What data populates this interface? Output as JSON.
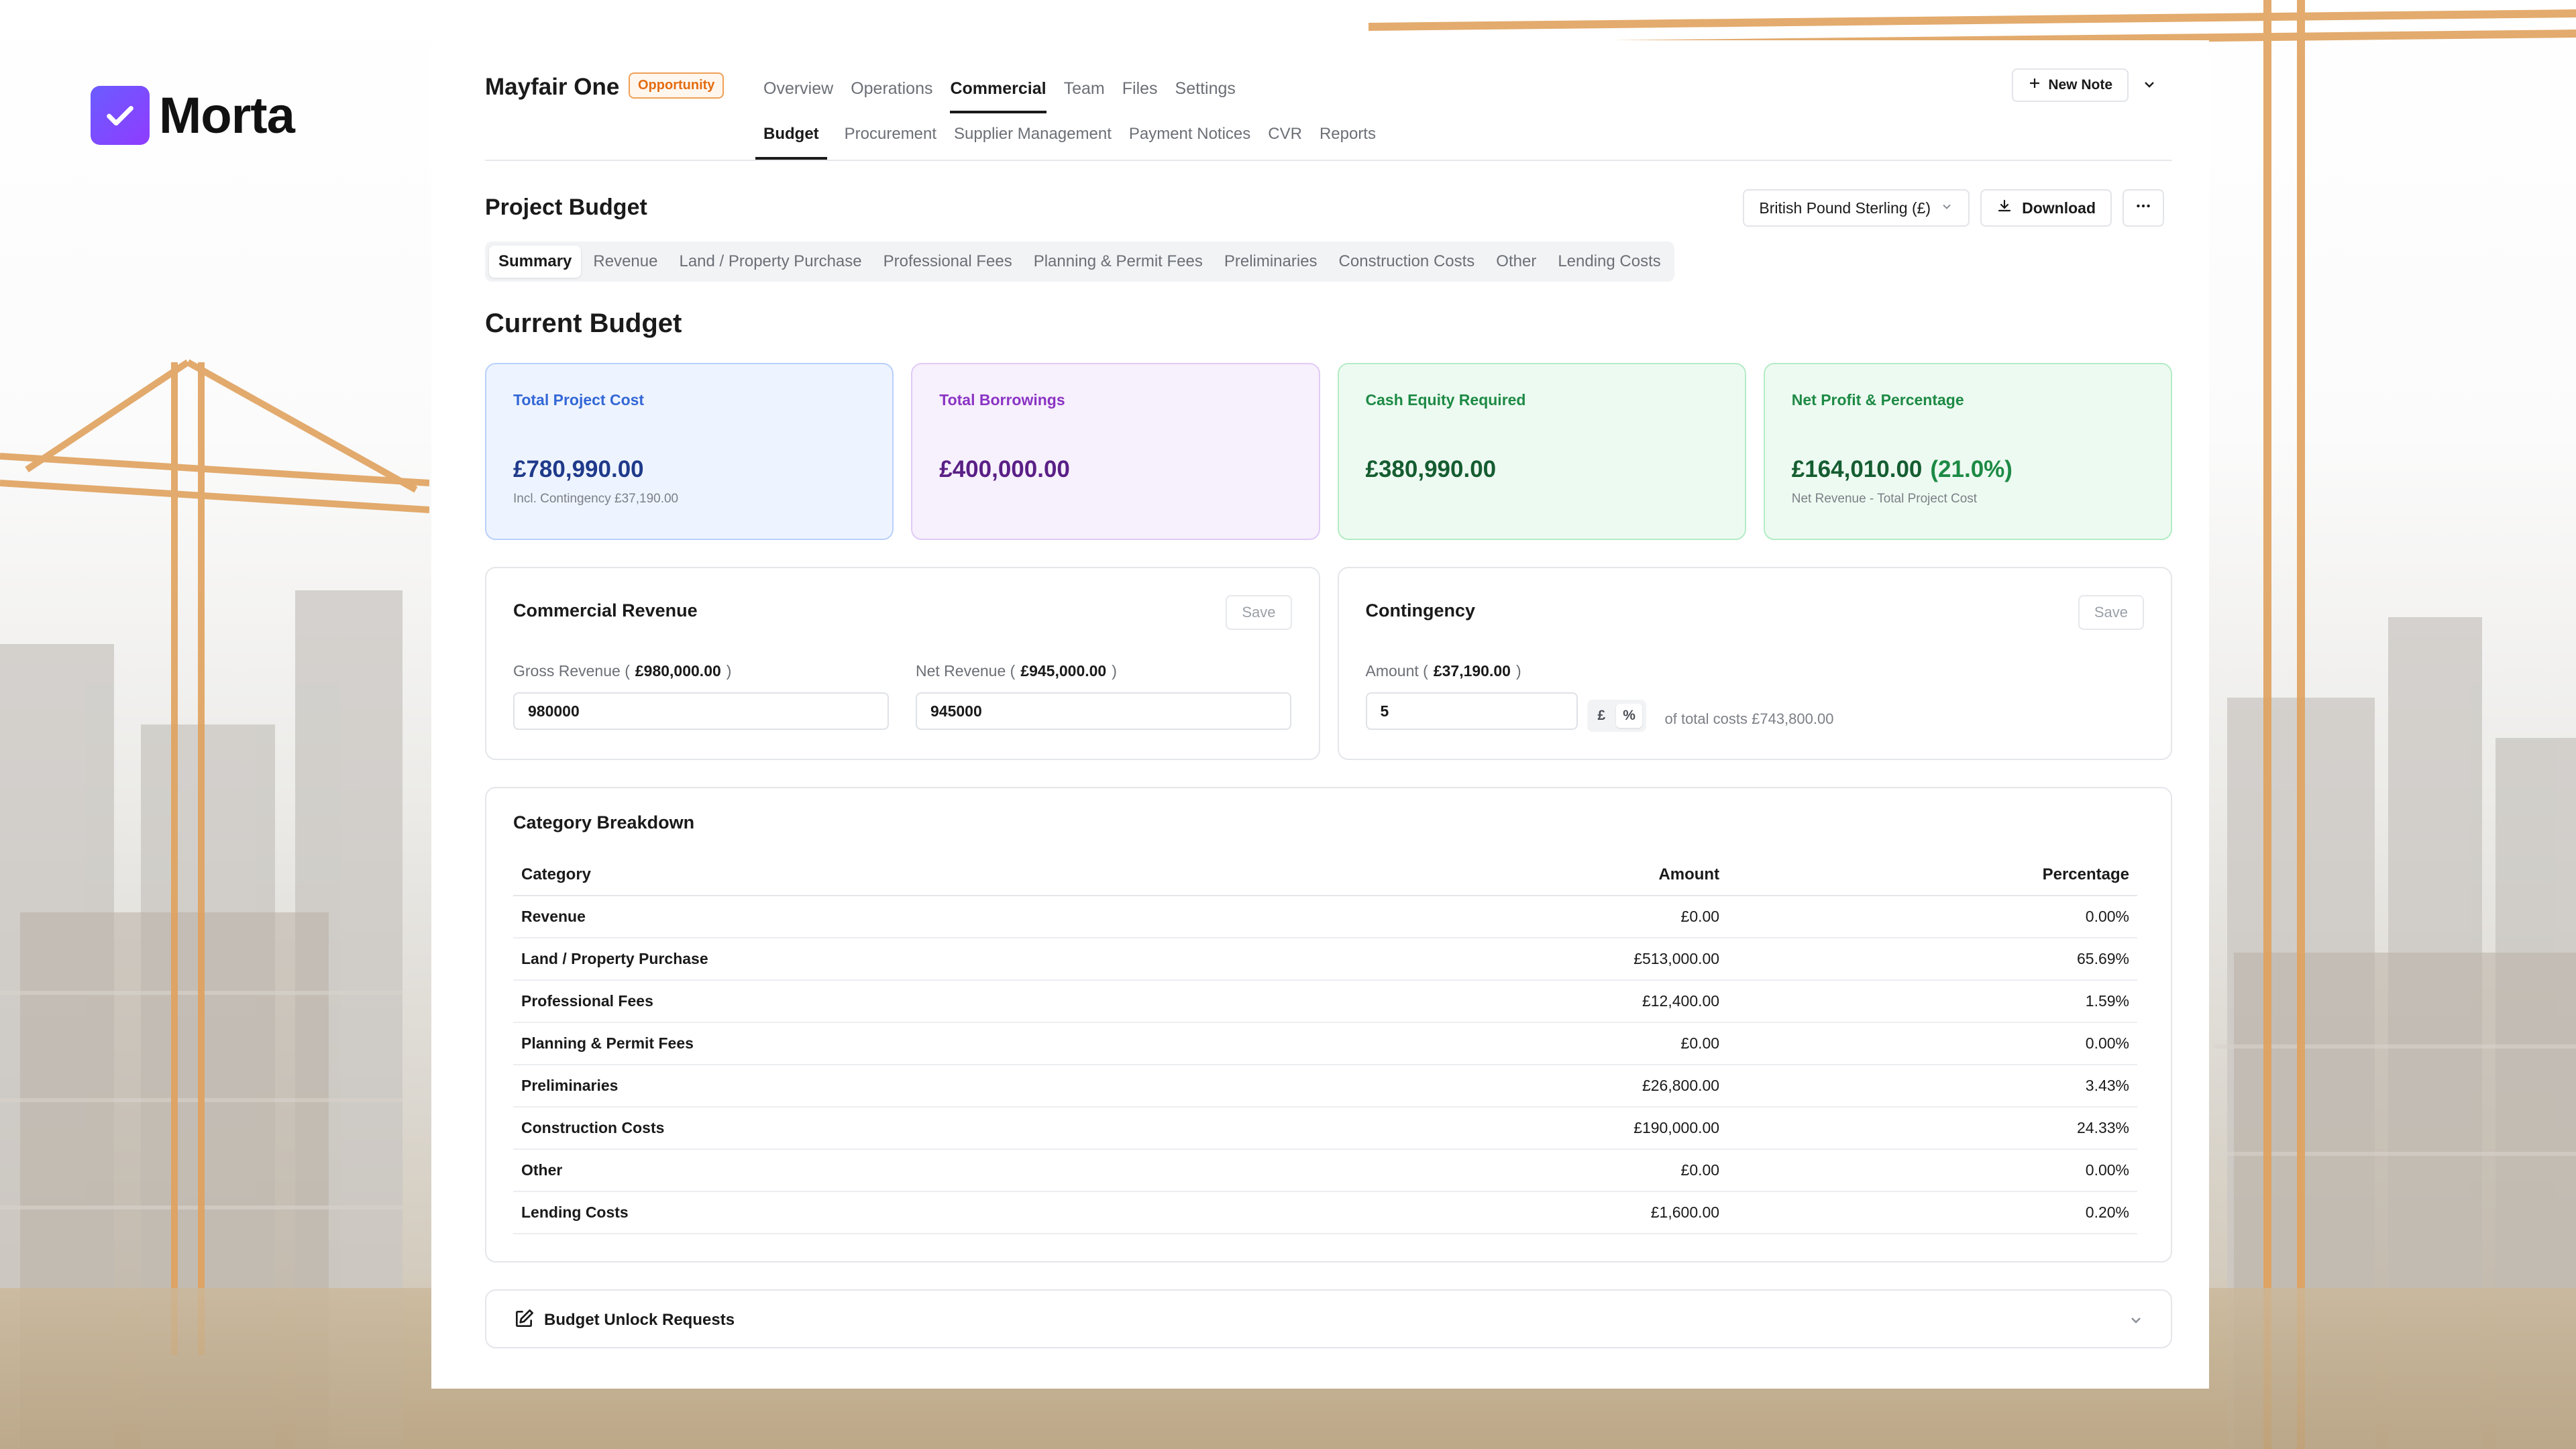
{
  "brand": {
    "name": "Morta"
  },
  "project": {
    "name": "Mayfair One",
    "status_badge": "Opportunity"
  },
  "top_nav": [
    "Overview",
    "Operations",
    "Commercial",
    "Team",
    "Files",
    "Settings"
  ],
  "top_nav_active": "Commercial",
  "new_note_label": "New Note",
  "sub_nav": [
    "Budget",
    "Procurement",
    "Supplier Management",
    "Payment Notices",
    "CVR",
    "Reports"
  ],
  "sub_nav_active": "Budget",
  "budget": {
    "title": "Project Budget",
    "currency_select": "British Pound Sterling (£)",
    "download_label": "Download",
    "tabs": [
      "Summary",
      "Revenue",
      "Land / Property Purchase",
      "Professional Fees",
      "Planning & Permit Fees",
      "Preliminaries",
      "Construction Costs",
      "Other",
      "Lending Costs"
    ],
    "active_tab": "Summary"
  },
  "current_budget": {
    "title": "Current Budget",
    "cards": {
      "total_project_cost": {
        "label": "Total Project Cost",
        "value": "£780,990.00",
        "sub": "Incl. Contingency £37,190.00"
      },
      "total_borrowings": {
        "label": "Total Borrowings",
        "value": "£400,000.00"
      },
      "cash_equity": {
        "label": "Cash Equity Required",
        "value": "£380,990.00"
      },
      "net_profit": {
        "label": "Net Profit & Percentage",
        "value": "£164,010.00",
        "pct": "(21.0%)",
        "sub": "Net Revenue - Total Project Cost"
      }
    }
  },
  "commercial_revenue": {
    "title": "Commercial Revenue",
    "save_label": "Save",
    "gross_label": "Gross Revenue",
    "gross_amount": "£980,000.00",
    "gross_value": "980000",
    "net_label": "Net Revenue",
    "net_amount": "£945,000.00",
    "net_value": "945000"
  },
  "contingency": {
    "title": "Contingency",
    "save_label": "Save",
    "amount_label": "Amount",
    "amount": "£37,190.00",
    "value": "5",
    "unit_pound": "£",
    "unit_percent": "%",
    "selected_unit": "%",
    "of_total": "of total costs £743,800.00"
  },
  "category_breakdown": {
    "title": "Category Breakdown",
    "columns": [
      "Category",
      "Amount",
      "Percentage"
    ],
    "rows": [
      {
        "category": "Revenue",
        "amount": "£0.00",
        "percentage": "0.00%"
      },
      {
        "category": "Land / Property Purchase",
        "amount": "£513,000.00",
        "percentage": "65.69%"
      },
      {
        "category": "Professional Fees",
        "amount": "£12,400.00",
        "percentage": "1.59%"
      },
      {
        "category": "Planning & Permit Fees",
        "amount": "£0.00",
        "percentage": "0.00%"
      },
      {
        "category": "Preliminaries",
        "amount": "£26,800.00",
        "percentage": "3.43%"
      },
      {
        "category": "Construction Costs",
        "amount": "£190,000.00",
        "percentage": "24.33%"
      },
      {
        "category": "Other",
        "amount": "£0.00",
        "percentage": "0.00%"
      },
      {
        "category": "Lending Costs",
        "amount": "£1,600.00",
        "percentage": "0.20%"
      }
    ]
  },
  "unlock_requests": {
    "label": "Budget Unlock Requests"
  },
  "colors": {
    "brand": "#7b4dff",
    "badge": "#e36c12",
    "card_blue": "#3367d6",
    "card_purple": "#8b34c4",
    "card_green": "#1d8a45"
  }
}
